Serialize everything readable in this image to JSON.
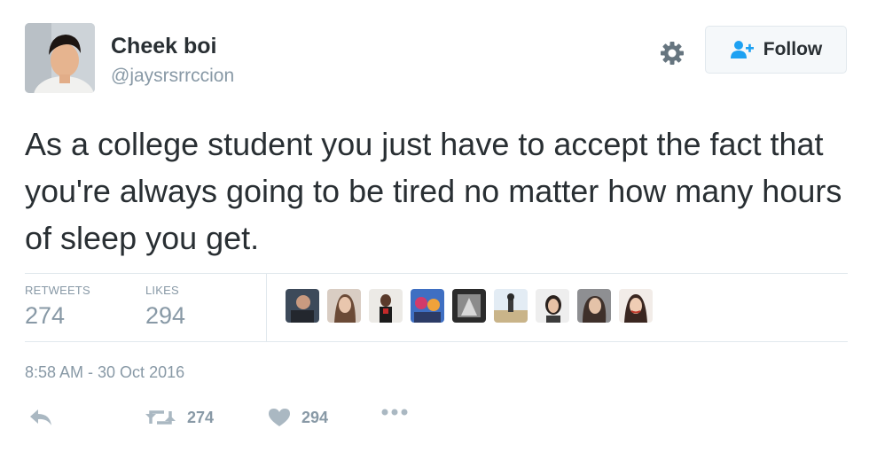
{
  "user": {
    "name": "Cheek boi",
    "handle": "@jaysrsrrccion"
  },
  "follow_button": {
    "label": "Follow"
  },
  "tweet": {
    "text": "As a college student you just have to accept the fact that you're always going to be tired no matter how many hours of sleep you get.",
    "timestamp": "8:58 AM - 30 Oct 2016"
  },
  "stats": {
    "retweets_label": "RETWEETS",
    "retweets_count": "274",
    "likes_label": "LIKES",
    "likes_count": "294"
  },
  "actions": {
    "retweet_count": "274",
    "like_count": "294"
  },
  "colors": {
    "text": "#292f33",
    "muted": "#8899a6",
    "follow_icon": "#1da1f2",
    "border": "#e1e8ed"
  },
  "icons": [
    "settings-gear-icon",
    "follow-person-icon",
    "reply-icon",
    "retweet-icon",
    "heart-icon",
    "more-dots-icon"
  ]
}
